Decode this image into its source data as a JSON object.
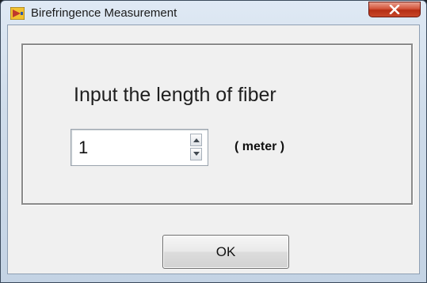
{
  "window": {
    "title": "Birefringence Measurement",
    "close_glyph": "x"
  },
  "dialog": {
    "prompt": "Input the length of fiber",
    "length_value": "1",
    "unit_label": "( meter )",
    "ok_label": "OK"
  },
  "icons": {
    "app": "labview-vi-icon",
    "close": "close-icon",
    "increment": "spin-up-icon",
    "decrement": "spin-down-icon"
  },
  "colors": {
    "close_button": "#c8472a",
    "titlebar": "#dfe9f4",
    "client_bg": "#f0f0f0"
  }
}
